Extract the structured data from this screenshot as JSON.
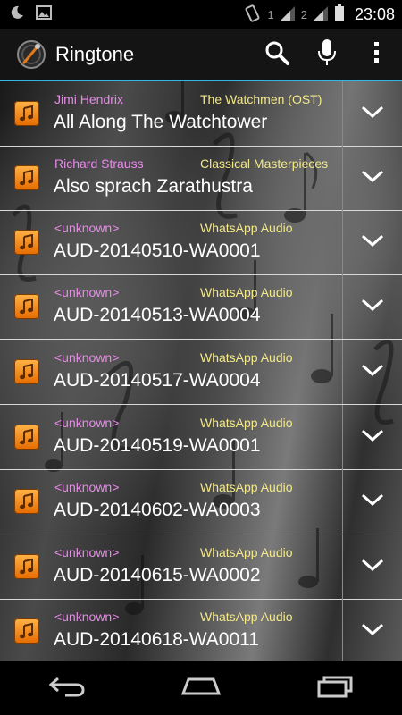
{
  "status_bar": {
    "time": "23:08",
    "sim1_label": "1",
    "sim2_label": "2"
  },
  "action_bar": {
    "title": "Ringtone",
    "accent_color": "#33b5e5"
  },
  "songs": [
    {
      "artist": "Jimi Hendrix",
      "album": "The Watchmen (OST)",
      "title": "All Along The Watchtower"
    },
    {
      "artist": "Richard Strauss",
      "album": "Classical Masterpieces",
      "title": "Also sprach Zarathustra"
    },
    {
      "artist": "<unknown>",
      "album": "WhatsApp Audio",
      "title": "AUD-20140510-WA0001"
    },
    {
      "artist": "<unknown>",
      "album": "WhatsApp Audio",
      "title": "AUD-20140513-WA0004"
    },
    {
      "artist": "<unknown>",
      "album": "WhatsApp Audio",
      "title": "AUD-20140517-WA0004"
    },
    {
      "artist": "<unknown>",
      "album": "WhatsApp Audio",
      "title": "AUD-20140519-WA0001"
    },
    {
      "artist": "<unknown>",
      "album": "WhatsApp Audio",
      "title": "AUD-20140602-WA0003"
    },
    {
      "artist": "<unknown>",
      "album": "WhatsApp Audio",
      "title": "AUD-20140615-WA0002"
    },
    {
      "artist": "<unknown>",
      "album": "WhatsApp Audio",
      "title": "AUD-20140618-WA0011"
    }
  ],
  "colors": {
    "artist": "#e88ae8",
    "album": "#f3e98a"
  }
}
